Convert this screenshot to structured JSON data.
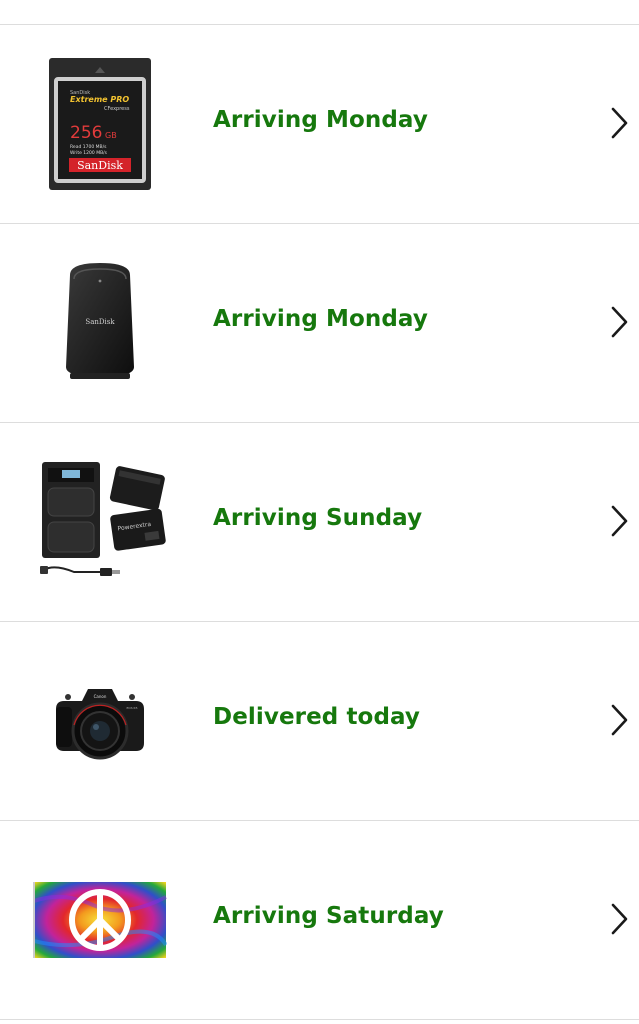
{
  "orders": [
    {
      "status": "Arriving Monday",
      "product_icon": "sandisk-cfexpress-card-icon",
      "product_text": {
        "brand_small": "SanDisk",
        "line": "Extreme PRO",
        "format": "CFexpress",
        "capacity": "256",
        "unit": "GB",
        "read": "Read 1700 MB/s",
        "write": "Write 1200 MB/s",
        "brand": "SanDisk"
      }
    },
    {
      "status": "Arriving Monday",
      "product_icon": "sandisk-card-reader-icon",
      "product_text": {
        "brand": "SanDisk"
      }
    },
    {
      "status": "Arriving Sunday",
      "product_icon": "battery-charger-kit-icon",
      "product_text": {
        "brand": "Powerextra"
      }
    },
    {
      "status": "Delivered today",
      "product_icon": "mirrorless-camera-icon",
      "product_text": {
        "brand": "Canon",
        "model": "EOS R5"
      }
    },
    {
      "status": "Arriving Saturday",
      "product_icon": "peace-sign-flag-icon",
      "product_text": {}
    }
  ],
  "chevron_icon": "chevron-right-icon",
  "colors": {
    "status_green": "#16780d",
    "divider": "#dddddd",
    "background": "#ffffff"
  }
}
